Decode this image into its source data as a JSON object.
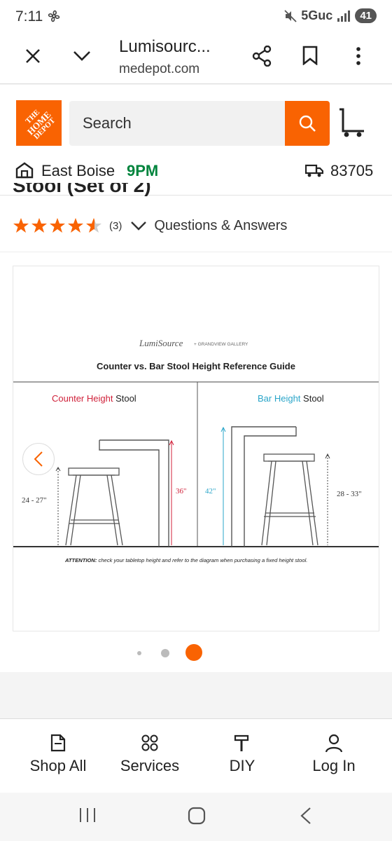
{
  "status_bar": {
    "time": "7:11",
    "network": "5Guc",
    "battery": "41"
  },
  "browser": {
    "title": "Lumisourc...",
    "url": "medepot.com"
  },
  "header": {
    "logo_lines": [
      "THE",
      "HOME",
      "DEPOT"
    ],
    "search_placeholder": "Search",
    "store_name": "East Boise",
    "store_hours": "9PM",
    "zip": "83705"
  },
  "product": {
    "title_fragment": "Stool (Set of 2)",
    "rating": 4.5,
    "review_count": "(3)",
    "qa_label": "Questions & Answers"
  },
  "diagram": {
    "brand": "LumiSource",
    "brand_suffix": "+ GRANDVIEW GALLERY",
    "heading": "Counter vs. Bar Stool Height  Reference Guide",
    "counter_label_colored": "Counter Height",
    "counter_label_plain": " Stool",
    "bar_label_colored": "Bar Height",
    "bar_label_plain": " Stool",
    "counter_seat_range": "24 - 27\"",
    "counter_table": "36\"",
    "bar_table": "42\"",
    "bar_seat_range": "28 - 33\"",
    "attention_label": "ATTENTION:",
    "attention_text": " check your tabletop height and refer to the diagram when purchasing a fixed height stool.",
    "colors": {
      "counter": "#d0213a",
      "bar": "#2aa5c9"
    }
  },
  "carousel": {
    "total": 3,
    "active": 3
  },
  "bottom_nav": [
    {
      "label": "Shop All",
      "icon": "catalog-icon"
    },
    {
      "label": "Services",
      "icon": "services-icon"
    },
    {
      "label": "DIY",
      "icon": "hammer-icon"
    },
    {
      "label": "Log In",
      "icon": "user-icon"
    }
  ],
  "colors": {
    "brand": "#f96302",
    "store_hours": "#00843d"
  }
}
